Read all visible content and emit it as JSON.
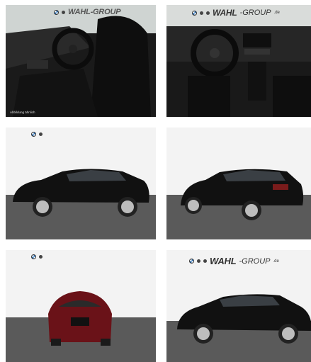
{
  "gallery": {
    "images": [
      {
        "name": "interior-side",
        "caption": "Abbildung ähnlich"
      },
      {
        "name": "interior-dashboard",
        "logo": {
          "brand": "WAHL",
          "suffix": "-GROUP",
          "domain": ".de"
        }
      },
      {
        "name": "exterior-side-left"
      },
      {
        "name": "exterior-rear-right"
      },
      {
        "name": "exterior-front-red"
      },
      {
        "name": "exterior-side-right",
        "logo": {
          "brand": "WAHL",
          "suffix": "-GROUP",
          "domain": ".de"
        }
      }
    ]
  },
  "colors": {
    "car_black": "#111111",
    "car_red": "#6a1218",
    "floor": "#5a5a5a",
    "backdrop": "#f0f0f0"
  }
}
